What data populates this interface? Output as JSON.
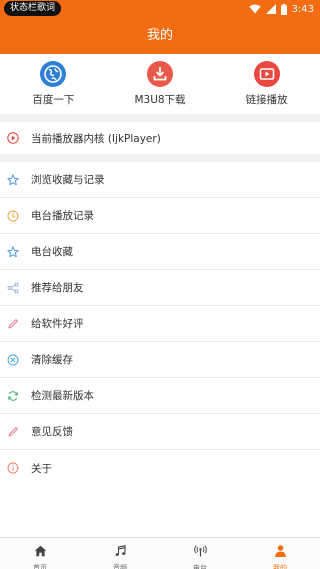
{
  "status_bar": {
    "lyric_label": "状态栏歌词",
    "time": "3:43"
  },
  "app_bar": {
    "title": "我的"
  },
  "quick_actions": [
    {
      "label": "百度一下",
      "icon": "globe-icon",
      "color": "#2f7fd6"
    },
    {
      "label": "M3U8下载",
      "icon": "download-icon",
      "color": "#e8594a"
    },
    {
      "label": "链接播放",
      "icon": "play-video-icon",
      "color": "#e8483f"
    }
  ],
  "player_kernel": {
    "label": "当前播放器内核 (IjkPlayer)",
    "icon": "play-circle-icon",
    "color": "#e53935"
  },
  "menu": [
    {
      "label": "浏览收藏与记录",
      "icon": "star-icon",
      "color": "#4a90e2"
    },
    {
      "label": "电台播放记录",
      "icon": "clock-icon",
      "color": "#f39a3c"
    },
    {
      "label": "电台收藏",
      "icon": "star-icon",
      "color": "#4a90e2"
    },
    {
      "label": "推荐给朋友",
      "icon": "share-icon",
      "color": "#8fb0d8"
    },
    {
      "label": "给软件好评",
      "icon": "pencil-icon",
      "color": "#e8728a"
    },
    {
      "label": "清除缓存",
      "icon": "clear-icon",
      "color": "#3aa6e8"
    },
    {
      "label": "检测最新版本",
      "icon": "refresh-icon",
      "color": "#3cb371"
    },
    {
      "label": "意见反馈",
      "icon": "pencil-icon",
      "color": "#e8728a"
    },
    {
      "label": "关于",
      "icon": "info-icon",
      "color": "#f07a5a"
    }
  ],
  "tabs": [
    {
      "label": "首页",
      "icon": "home-icon",
      "active": false
    },
    {
      "label": "音频",
      "icon": "music-note-icon",
      "active": false
    },
    {
      "label": "电台",
      "icon": "radio-icon",
      "active": false
    },
    {
      "label": "我的",
      "icon": "person-icon",
      "active": true
    }
  ],
  "colors": {
    "primary": "#f36c14",
    "background": "#f2f2f2"
  }
}
